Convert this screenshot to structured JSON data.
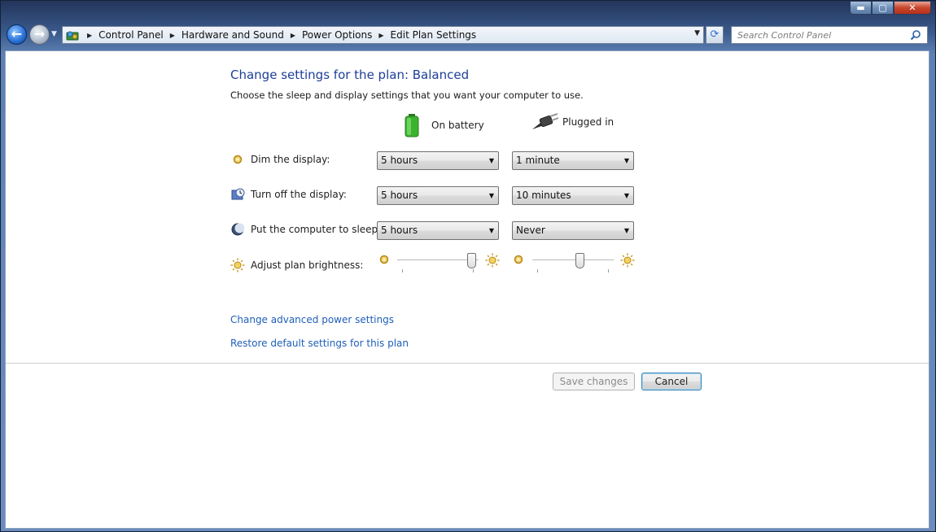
{
  "window": {
    "minimize_glyph": "▬",
    "maximize_glyph": "▢",
    "close_glyph": "✕"
  },
  "navigation": {
    "back_glyph": "←",
    "forward_glyph": "→",
    "breadcrumbs": [
      "Control Panel",
      "Hardware and Sound",
      "Power Options",
      "Edit Plan Settings"
    ],
    "search_placeholder": "Search Control Panel"
  },
  "page": {
    "title": "Change settings for the plan: Balanced",
    "subtitle": "Choose the sleep and display settings that you want your computer to use.",
    "columns": {
      "battery": "On battery",
      "plugged": "Plugged in"
    },
    "rows": {
      "dim": {
        "label": "Dim the display:",
        "battery": "5 hours",
        "plugged": "1 minute"
      },
      "display_off": {
        "label": "Turn off the display:",
        "battery": "5 hours",
        "plugged": "10 minutes"
      },
      "sleep": {
        "label": "Put the computer to sleep:",
        "battery": "5 hours",
        "plugged": "Never"
      },
      "brightness": {
        "label": "Adjust plan brightness:",
        "battery_level_pct": 97,
        "plugged_level_pct": 60
      }
    },
    "links": {
      "advanced": "Change advanced power settings",
      "restore": "Restore default settings for this plan"
    },
    "buttons": {
      "save": "Save changes",
      "cancel": "Cancel"
    }
  },
  "colors": {
    "title": "#1e3f98",
    "link": "#1f5fb8",
    "battery": "#3cb32f",
    "brightness_icon": "#d6a318"
  }
}
